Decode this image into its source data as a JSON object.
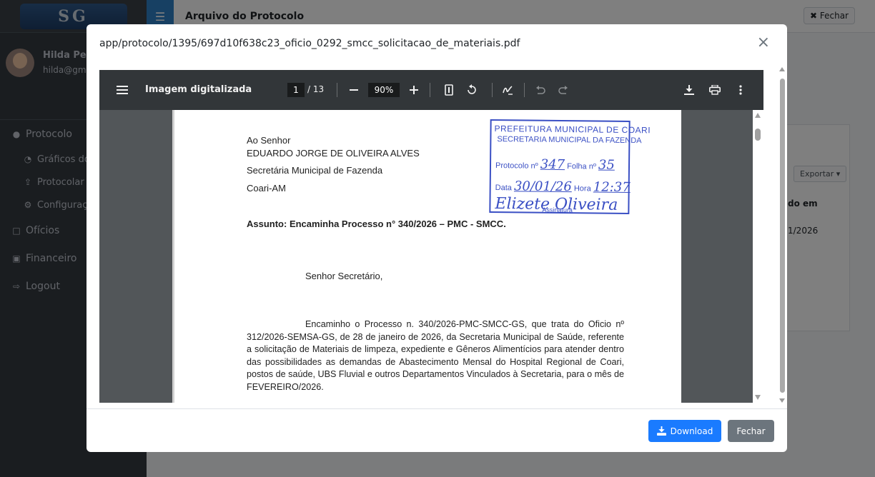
{
  "app": {
    "logo_text": "SG",
    "user_name": "Hilda Pere",
    "user_email": "hilda@gma",
    "nav": [
      {
        "label": "Protocolo",
        "icon": "protocol-icon"
      },
      {
        "label": "Gráficos do",
        "icon": "pie-chart-icon"
      },
      {
        "label": "Protocolar",
        "icon": "upload-icon"
      },
      {
        "label": "Configuraç",
        "icon": "gears-icon"
      },
      {
        "label": "Ofícios",
        "icon": "file-icon"
      },
      {
        "label": "Financeiro",
        "icon": "money-icon"
      },
      {
        "label": "Logout",
        "icon": "logout-icon"
      }
    ],
    "page_title": "Arquivo do Protocolo",
    "top_close_label": "Fechar",
    "export_label": "Exportar",
    "column_header": "do em",
    "cell_date": "1/2026"
  },
  "modal": {
    "title": "app/protocolo/1395/697d10f638c23_oficio_0292_smcc_solicitacao_de_materiais.pdf",
    "close_symbol": "×",
    "download_label": "Download",
    "fechar_label": "Fechar"
  },
  "pdf": {
    "document_title": "Imagem digitalizada",
    "current_page": "1",
    "total_pages": "/ 13",
    "zoom": "90%",
    "letter": {
      "line1": "Ao Senhor",
      "line2": "EDUARDO JORGE DE OLIVEIRA ALVES",
      "line3": "Secretária Municipal de Fazenda",
      "line4": "Coari-AM",
      "subject": "Assunto:  Encaminha Processo n° 340/2026 – PMC - SMCC.",
      "greeting": "Senhor Secretário,",
      "body": "Encaminho o Processo n. 340/2026-PMC-SMCC-GS, que trata do Oficio nº 312/2026-SEMSA-GS, de 28 de janeiro de 2026, da Secretaria Municipal de Saúde, referente a solicitação de Materiais de limpeza, expediente e Gêneros Alimentícios para atender dentro das possibilidades as demandas de Abastecimento Mensal do Hospital Regional de Coari, postos de saúde, UBS Fluvial e outros Departamentos Vinculados à Secretaria, para o mês de FEVEREIRO/2026."
    },
    "stamp": {
      "line1": "PREFEITURA MUNICIPAL DE COARI",
      "line2": "SECRETARIA MUNICIPAL DA FAZENDA",
      "protocolo_label": "Protocolo nº",
      "protocolo_value": "347",
      "folha_label": "Folha nº",
      "folha_value": "35",
      "data_label": "Data",
      "data_value": "30/01/26",
      "hora_label": "Hora",
      "hora_value": "12:37",
      "signature": "Elizete Oliveira",
      "assinatura_label": "Assinatura"
    }
  }
}
